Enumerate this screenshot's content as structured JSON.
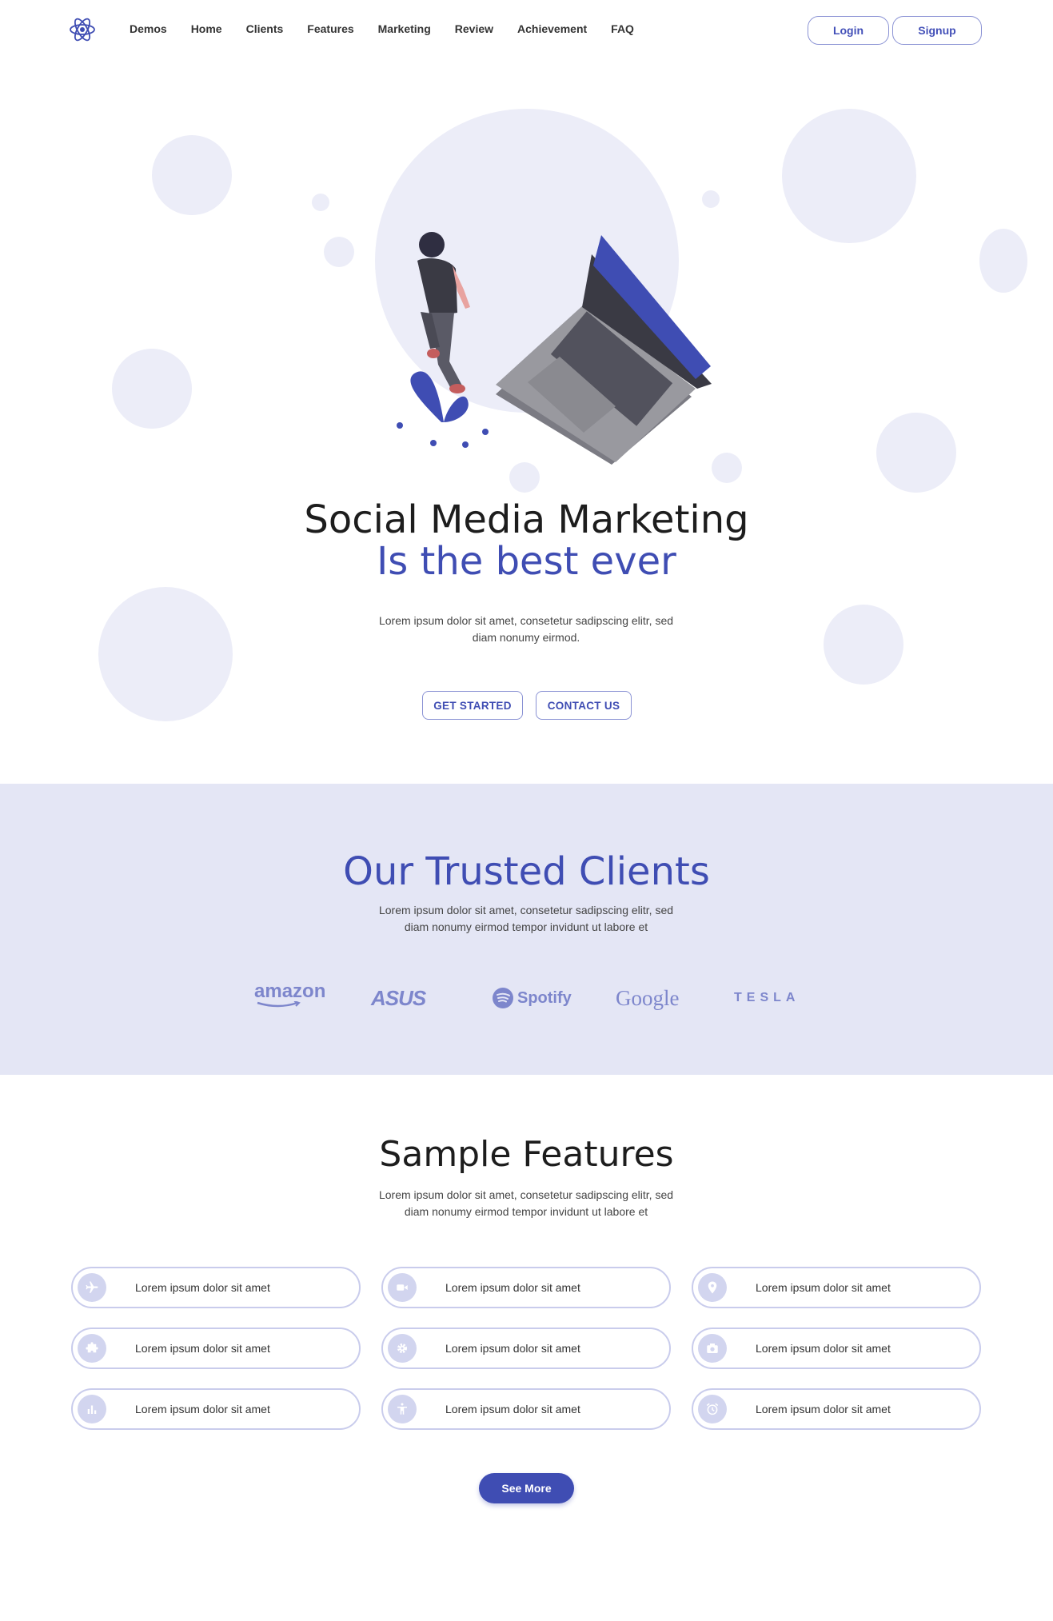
{
  "nav": {
    "items": [
      "Demos",
      "Home",
      "Clients",
      "Features",
      "Marketing",
      "Review",
      "Achievement",
      "FAQ"
    ],
    "login": "Login",
    "signup": "Signup"
  },
  "hero": {
    "title": "Social Media Marketing",
    "subtitle": "Is the best ever",
    "text": "Lorem ipsum dolor sit amet, consetetur sadipscing elitr, sed diam nonumy eirmod.",
    "get_started": "GET STARTED",
    "contact_us": "CONTACT US"
  },
  "clients": {
    "title": "Our Trusted Clients",
    "text": "Lorem ipsum dolor sit amet, consetetur sadipscing elitr, sed diam nonumy eirmod tempor invidunt ut labore et",
    "logos": [
      "amazon",
      "ASUS",
      "Spotify",
      "Google",
      "TESLA"
    ]
  },
  "features": {
    "title": "Sample Features",
    "text": "Lorem ipsum dolor sit amet, consetetur sadipscing elitr, sed diam nonumy eirmod tempor invidunt ut labore et",
    "items": [
      {
        "icon": "airplane-icon",
        "label": "Lorem ipsum dolor sit amet"
      },
      {
        "icon": "video-camera-icon",
        "label": "Lorem ipsum dolor sit amet"
      },
      {
        "icon": "location-pin-icon",
        "label": "Lorem ipsum dolor sit amet"
      },
      {
        "icon": "puzzle-icon",
        "label": "Lorem ipsum dolor sit amet"
      },
      {
        "icon": "gear-icon",
        "label": "Lorem ipsum dolor sit amet"
      },
      {
        "icon": "camera-icon",
        "label": "Lorem ipsum dolor sit amet"
      },
      {
        "icon": "bar-chart-icon",
        "label": "Lorem ipsum dolor sit amet"
      },
      {
        "icon": "accessibility-icon",
        "label": "Lorem ipsum dolor sit amet"
      },
      {
        "icon": "alarm-clock-icon",
        "label": "Lorem ipsum dolor sit amet"
      }
    ],
    "see_more": "See More"
  },
  "colors": {
    "accent": "#3f4db3",
    "light_bg": "#e4e6f5",
    "bubble": "#ecedf8"
  }
}
